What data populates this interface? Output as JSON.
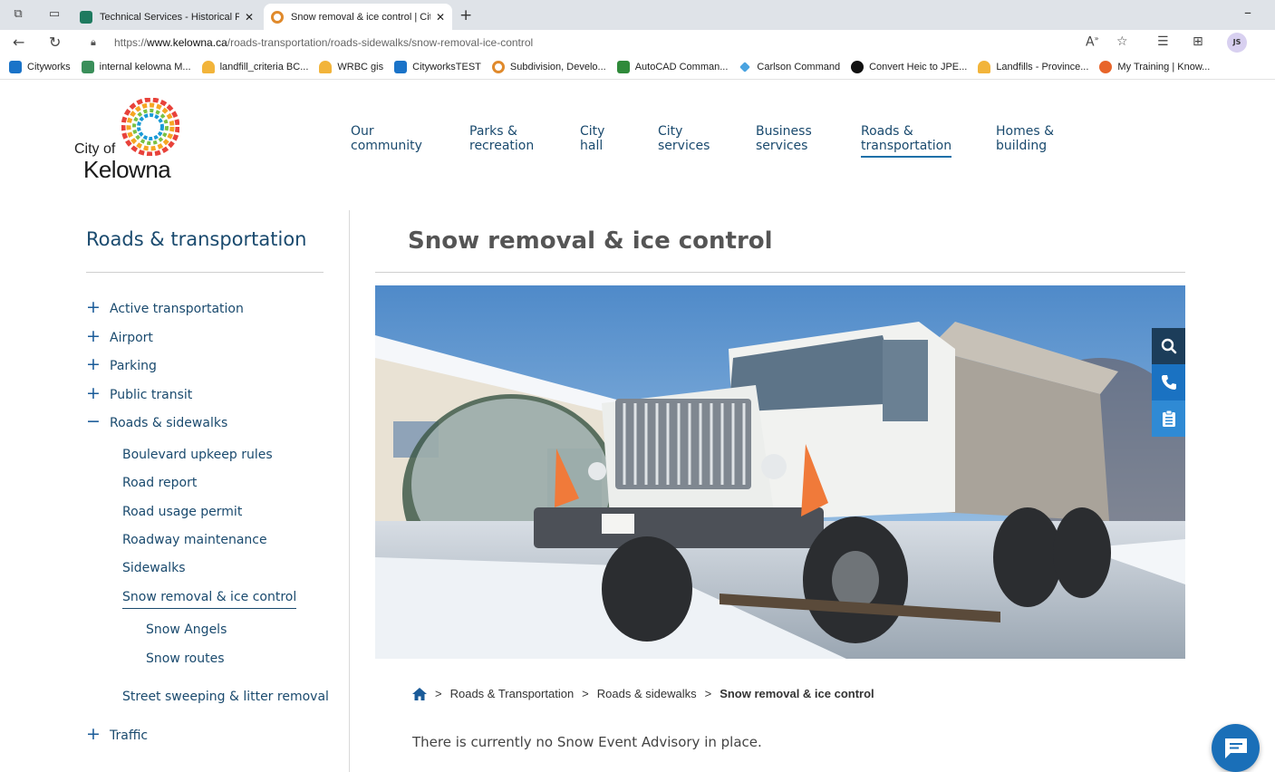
{
  "browser": {
    "tabs": [
      {
        "title": "Technical Services - Historical File",
        "active": false
      },
      {
        "title": "Snow removal & ice control | City",
        "active": true
      }
    ],
    "url_scheme": "https://",
    "url_host": "www.kelowna.ca",
    "url_path": "/roads-transportation/roads-sidewalks/snow-removal-ice-control",
    "profile_initials": "JS",
    "favorites": [
      "Cityworks",
      "internal kelowna M...",
      "landfill_criteria BC...",
      "WRBC gis",
      "CityworksTEST",
      "Subdivision, Develo...",
      "AutoCAD Comman...",
      "Carlson Command",
      "Convert Heic to JPE...",
      "Landfills - Province...",
      "My Training | Know..."
    ]
  },
  "site": {
    "logo_city_of": "City of",
    "logo_name": "Kelowna",
    "nav": [
      {
        "line1": "Our",
        "line2": "community"
      },
      {
        "line1": "Parks &",
        "line2": "recreation"
      },
      {
        "line1": "City",
        "line2": "hall"
      },
      {
        "line1": "City",
        "line2": "services"
      },
      {
        "line1": "Business",
        "line2": "services"
      },
      {
        "line1": "Roads &",
        "line2": "transportation"
      },
      {
        "line1": "Homes &",
        "line2": "building"
      }
    ]
  },
  "sidebar": {
    "title": "Roads & transportation",
    "items": [
      {
        "label": "Active transportation",
        "sign": "+"
      },
      {
        "label": "Airport",
        "sign": "+"
      },
      {
        "label": "Parking",
        "sign": "+"
      },
      {
        "label": "Public transit",
        "sign": "+"
      },
      {
        "label": "Roads & sidewalks",
        "sign": "−"
      },
      {
        "label": "Boulevard upkeep rules"
      },
      {
        "label": "Road report"
      },
      {
        "label": "Road usage permit"
      },
      {
        "label": "Roadway maintenance"
      },
      {
        "label": "Sidewalks"
      },
      {
        "label": "Snow removal & ice control"
      },
      {
        "label": "Snow Angels"
      },
      {
        "label": "Snow routes"
      },
      {
        "label": "Street sweeping & litter removal"
      },
      {
        "label": "Traffic",
        "sign": "+"
      }
    ]
  },
  "main": {
    "title": "Snow removal & ice control",
    "breadcrumb": {
      "sep": ">",
      "items": [
        "Roads & Transportation",
        "Roads & sidewalks",
        "Snow removal & ice control"
      ]
    },
    "advisory": "There is currently no Snow Event Advisory in place."
  },
  "colors": {
    "accent": "#1a4a6e",
    "link_underline": "#1a6fa8",
    "tool_dark": "#1c3d5a",
    "tool_blue": "#1a72c2",
    "chat_blue": "#1a6fb8"
  },
  "icons": [
    "home-icon",
    "search-icon",
    "phone-icon",
    "clipboard-icon",
    "chat-icon"
  ]
}
